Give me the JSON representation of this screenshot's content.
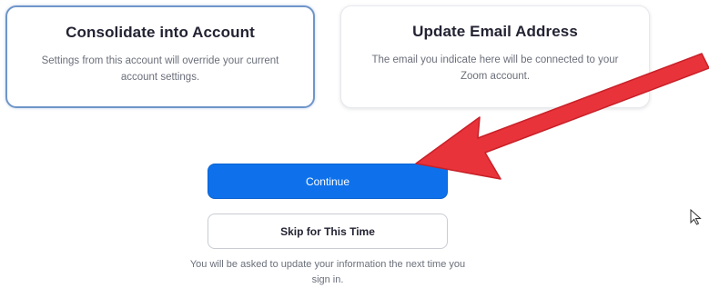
{
  "options": {
    "consolidate": {
      "title": "Consolidate into Account",
      "description": "Settings from this account will override your current account settings."
    },
    "update_email": {
      "title": "Update Email Address",
      "description": "The email you indicate here will be connected to your Zoom account."
    }
  },
  "actions": {
    "continue_label": "Continue",
    "skip_label": "Skip for This Time"
  },
  "footer": {
    "note": "You will be asked to update your information the next time you sign in."
  },
  "colors": {
    "primary_button": "#0e71eb",
    "selected_border": "#6f95c9",
    "annotation_arrow": "#e8333a"
  },
  "icons": {
    "arrow": "annotation-arrow-icon",
    "cursor": "mouse-cursor-icon"
  }
}
